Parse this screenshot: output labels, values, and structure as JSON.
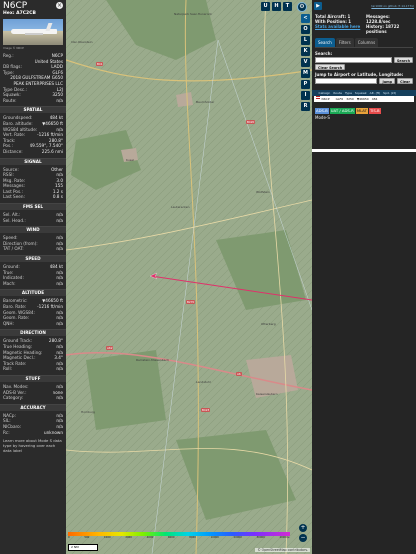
{
  "info": {
    "registration": "N6CP",
    "hex_label": "Hex:",
    "hex": "A7C2CB",
    "photo_credit": "Image © N6CP",
    "details": [
      {
        "k": "Reg.:",
        "v": "N6CP"
      },
      {
        "k": "",
        "v": "United States"
      },
      {
        "k": "DB flags:",
        "v": "LADD"
      },
      {
        "k": "Type:",
        "v": "GLF6"
      },
      {
        "k": "",
        "v": "2018 GULFSTREAM G650"
      },
      {
        "k": "",
        "v": "PEAK ENTERPRISES LLC"
      },
      {
        "k": "Type Desc.:",
        "v": "L2J"
      },
      {
        "k": "Squawk:",
        "v": "3250"
      },
      {
        "k": "Route:",
        "v": "n/a"
      }
    ],
    "spatial_title": "SPATIAL",
    "spatial": [
      {
        "k": "Groundspeed:",
        "v": "484 kt"
      },
      {
        "k": "Baro. altitude:",
        "v": "▼46650 ft"
      },
      {
        "k": "WGS84 altitude:",
        "v": "n/a"
      },
      {
        "k": "Vert. Rate:",
        "v": "-1216 ft/min"
      },
      {
        "k": "Track:",
        "v": "280.8°"
      },
      {
        "k": "Pos.:",
        "v": "49.559°, 7.540°"
      },
      {
        "k": "Distance:",
        "v": "225.6 nmi"
      }
    ],
    "signal_title": "SIGNAL",
    "signal": [
      {
        "k": "Source:",
        "v": "Other"
      },
      {
        "k": "RSSI:",
        "v": "n/a"
      },
      {
        "k": "Msg. Rate:",
        "v": "3.0"
      },
      {
        "k": "Messages:",
        "v": "155"
      },
      {
        "k": "Last Pos.:",
        "v": "1.2 s"
      },
      {
        "k": "Last Seen:",
        "v": "0.8 s"
      }
    ],
    "fms_title": "FMS SEL",
    "fms": [
      {
        "k": "Sel. Alt.:",
        "v": "n/a"
      },
      {
        "k": "Sel. Head.:",
        "v": "n/a"
      }
    ],
    "wind_title": "WIND",
    "wind": [
      {
        "k": "Speed:",
        "v": "n/a"
      },
      {
        "k": "Direction (from):",
        "v": "n/a"
      },
      {
        "k": "TAT / OAT:",
        "v": "n/a"
      }
    ],
    "speed_title": "SPEED",
    "speed": [
      {
        "k": "Ground:",
        "v": "484 kt"
      },
      {
        "k": "True:",
        "v": "n/a"
      },
      {
        "k": "Indicated:",
        "v": "n/a"
      },
      {
        "k": "Mach:",
        "v": "n/a"
      }
    ],
    "altitude_title": "ALTITUDE",
    "altitude": [
      {
        "k": "Barometric:",
        "v": "▼46650 ft"
      },
      {
        "k": "Baro. Rate:",
        "v": "-1216 ft/min"
      },
      {
        "k": "Geom. WGS84:",
        "v": "n/a"
      },
      {
        "k": "Geom. Rate:",
        "v": "n/a"
      },
      {
        "k": "QNH:",
        "v": "n/a"
      }
    ],
    "direction_title": "DIRECTION",
    "direction": [
      {
        "k": "Ground Track:",
        "v": "280.8°"
      },
      {
        "k": "True Heading:",
        "v": "n/a"
      },
      {
        "k": "Magnetic Heading:",
        "v": "n/a"
      },
      {
        "k": "Magnetic Decl.:",
        "v": "3.4°"
      },
      {
        "k": "Track Rate:",
        "v": "n/a"
      },
      {
        "k": "Roll:",
        "v": "n/a"
      }
    ],
    "stuff_title": "STUFF",
    "stuff": [
      {
        "k": "Nav. Modes:",
        "v": "n/a"
      },
      {
        "k": "ADS-B Ver.:",
        "v": "none"
      },
      {
        "k": "Category:",
        "v": "n/a"
      }
    ],
    "accuracy_title": "ACCURACY",
    "accuracy": [
      {
        "k": "NACp:",
        "v": "n/a"
      },
      {
        "k": "SIL:",
        "v": "n/a"
      },
      {
        "k": "NICbaro:",
        "v": "n/a"
      },
      {
        "k": "Rc:",
        "v": "unknown"
      }
    ],
    "help_text": "Learn more about Mode S data type by hovering over each data label"
  },
  "map": {
    "top_buttons": [
      "U",
      "H",
      "T"
    ],
    "side_buttons": [
      "<",
      "O",
      "L",
      "K",
      "V",
      "M",
      "P",
      "I",
      "R"
    ],
    "colorbar_ticks": [
      "0",
      "500",
      "1000",
      "2000",
      "4000",
      "6000",
      "8000",
      "10000",
      "20000",
      "30000",
      "40000+"
    ],
    "scale": "2 NM",
    "attribution": "© OpenStreetMap contributors.",
    "labels": {
      "park": "Naturpark Saar-Hunsrück",
      "city1": "Kusel",
      "city2": "Kaiserslautern",
      "city3": "Ramstein-Miesenbach",
      "city4": "Landstuhl",
      "city5": "Baumholder",
      "city6": "Homburg",
      "city7": "Lauterecken",
      "city8": "Wolfstein",
      "city9": "Otterberg",
      "city10": "Idar-Oberstein"
    },
    "road_tags": [
      "B41",
      "B420",
      "A62",
      "B270",
      "A6",
      "B423"
    ]
  },
  "right": {
    "version": "tar1090 on github (7.14.1771)",
    "total_label": "Total Aircraft:",
    "total": "1",
    "with_pos_label": "With Position:",
    "with_pos": "1",
    "stats_link": "Stats available here",
    "messages_label": "Messages:",
    "messages": "1228.8/sec",
    "history_label": "History:",
    "history": "18722 positions",
    "tabs": [
      "Search",
      "Filters",
      "Columns"
    ],
    "search_label": "Search:",
    "search_button": "Search",
    "clear_button": "Clear Search",
    "jump_label": "Jump to Airport or Latitude, Longitude:",
    "jump_button": "Jump",
    "clear_small": "Clear",
    "columns": [
      "",
      "Callsign",
      "Route",
      "Type",
      "Squawk",
      "Alt. (ft)",
      "Spd. (kt)"
    ],
    "row": [
      "",
      "N6CP",
      "",
      "GLF6",
      "3250",
      "▼46650",
      "484"
    ],
    "legend": [
      "ADS-B",
      "UAT / ADS-R",
      "MLAT",
      "TIS-B"
    ],
    "modes": "Mode-S"
  }
}
